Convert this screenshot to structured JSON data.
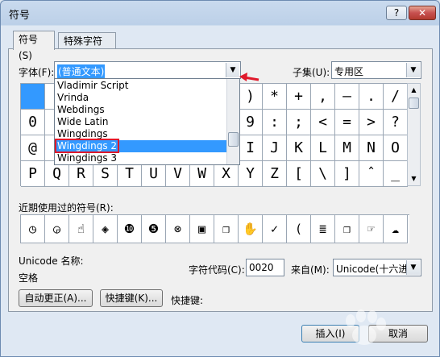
{
  "window": {
    "title": "符号",
    "help_label": "?",
    "close_label": "✕"
  },
  "tabs": [
    {
      "label": "符号(S)"
    },
    {
      "label": "特殊字符(P)"
    }
  ],
  "font": {
    "label": "字体(F):",
    "value": "(普通文本)"
  },
  "subset": {
    "label": "子集(U):",
    "value": "专用区"
  },
  "font_dropdown": {
    "items": [
      "Vladimir Script",
      "Vrinda",
      "Webdings",
      "Wide Latin",
      "Wingdings",
      "Wingdings 2",
      "Wingdings 3"
    ],
    "selected": "Wingdings 2"
  },
  "symbol_grid": {
    "rows": [
      [
        "",
        "",
        "",
        "",
        "",
        "",
        "",
        "",
        "",
        ")",
        "*",
        "+",
        ",",
        "–",
        ".",
        "/"
      ],
      [
        "0",
        "",
        "",
        "",
        "",
        "",
        "",
        "",
        "",
        "9",
        ":",
        ";",
        "<",
        "=",
        ">",
        "?"
      ],
      [
        "@",
        "",
        "",
        "",
        "",
        "",
        "",
        "",
        "",
        "I",
        "J",
        "K",
        "L",
        "M",
        "N",
        "O"
      ],
      [
        "P",
        "Q",
        "R",
        "S",
        "T",
        "U",
        "V",
        "W",
        "X",
        "Y",
        "Z",
        "[",
        "\\",
        "]",
        "ˆ",
        "_"
      ]
    ],
    "selected_cell": "row0-col0"
  },
  "recent": {
    "label": "近期使用过的符号(R):",
    "icons": [
      "clock-icon",
      "clock-icon",
      "hand-pointer-icon",
      "diamond-target-icon",
      "number-10-icon",
      "number-5-icon",
      "circled-x-icon",
      "square-frame-icon",
      "stacked-pages-icon",
      "raised-hand-icon",
      "checkmark-icon",
      "paren-icon",
      "list-icon",
      "stacked-pages-icon",
      "pointer-folder-icon",
      "cloud-hand-icon"
    ],
    "glyphs": [
      "◷",
      "◶",
      "☝",
      "◈",
      "❿",
      "❺",
      "⊗",
      "▣",
      "❐",
      "✋",
      "✓",
      "(",
      "≣",
      "❐",
      "☞",
      "☁"
    ]
  },
  "unicode": {
    "name_label": "Unicode 名称:",
    "name_value": "空格"
  },
  "char_code": {
    "label": "字符代码(C):",
    "value": "0020"
  },
  "from": {
    "label": "来自(M):",
    "value": "Unicode(十六进"
  },
  "buttons": {
    "autocorrect": "自动更正(A)...",
    "shortcut": "快捷键(K)...",
    "shortcut_label": "快捷键:",
    "insert": "插入(I)",
    "cancel": "取消"
  },
  "colors": {
    "selection": "#3399ff",
    "annotation_red": "#e0192b"
  }
}
